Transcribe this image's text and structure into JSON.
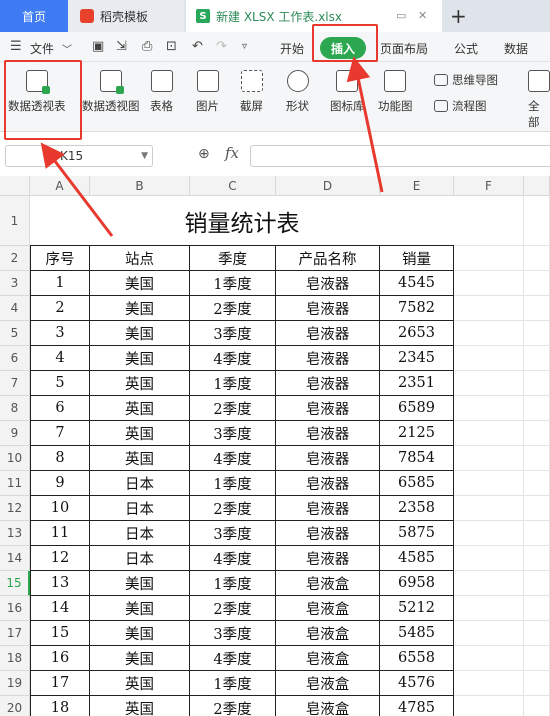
{
  "tabs": {
    "home": "首页",
    "template": "稻壳模板",
    "doc": "新建 XLSX 工作表.xlsx",
    "new_tab": "+"
  },
  "menubar": {
    "file": "文件",
    "items": [
      "开始",
      "插入",
      "页面布局",
      "公式",
      "数据"
    ],
    "active": "插入"
  },
  "ribbon": {
    "pivot_table": "数据透视表",
    "pivot_chart": "数据透视图",
    "table": "表格",
    "picture": "图片",
    "screenshot": "截屏",
    "shape": "形状",
    "icon_lib": "图标库",
    "function_chart": "功能图",
    "mindmap": "思维导图",
    "flowchart": "流程图",
    "more": "全部"
  },
  "formula_bar": {
    "name_box": "K15",
    "fx": "fx",
    "value": ""
  },
  "columns": [
    "A",
    "B",
    "C",
    "D",
    "E",
    "F"
  ],
  "active_row": "15",
  "sheet": {
    "title": "销量统计表",
    "headers": [
      "序号",
      "站点",
      "季度",
      "产品名称",
      "销量"
    ],
    "rows": [
      {
        "row": "3",
        "cells": [
          "1",
          "美国",
          "1季度",
          "皂液器",
          "4545"
        ]
      },
      {
        "row": "4",
        "cells": [
          "2",
          "美国",
          "2季度",
          "皂液器",
          "7582"
        ]
      },
      {
        "row": "5",
        "cells": [
          "3",
          "美国",
          "3季度",
          "皂液器",
          "2653"
        ]
      },
      {
        "row": "6",
        "cells": [
          "4",
          "美国",
          "4季度",
          "皂液器",
          "2345"
        ]
      },
      {
        "row": "7",
        "cells": [
          "5",
          "英国",
          "1季度",
          "皂液器",
          "2351"
        ]
      },
      {
        "row": "8",
        "cells": [
          "6",
          "英国",
          "2季度",
          "皂液器",
          "6589"
        ]
      },
      {
        "row": "9",
        "cells": [
          "7",
          "英国",
          "3季度",
          "皂液器",
          "2125"
        ]
      },
      {
        "row": "10",
        "cells": [
          "8",
          "英国",
          "4季度",
          "皂液器",
          "7854"
        ]
      },
      {
        "row": "11",
        "cells": [
          "9",
          "日本",
          "1季度",
          "皂液器",
          "6585"
        ]
      },
      {
        "row": "12",
        "cells": [
          "10",
          "日本",
          "2季度",
          "皂液器",
          "2358"
        ]
      },
      {
        "row": "13",
        "cells": [
          "11",
          "日本",
          "3季度",
          "皂液器",
          "5875"
        ]
      },
      {
        "row": "14",
        "cells": [
          "12",
          "日本",
          "4季度",
          "皂液器",
          "4585"
        ]
      },
      {
        "row": "15",
        "cells": [
          "13",
          "美国",
          "1季度",
          "皂液盒",
          "6958"
        ]
      },
      {
        "row": "16",
        "cells": [
          "14",
          "美国",
          "2季度",
          "皂液盒",
          "5212"
        ]
      },
      {
        "row": "17",
        "cells": [
          "15",
          "美国",
          "3季度",
          "皂液盒",
          "5485"
        ]
      },
      {
        "row": "18",
        "cells": [
          "16",
          "美国",
          "4季度",
          "皂液盒",
          "6558"
        ]
      },
      {
        "row": "19",
        "cells": [
          "17",
          "英国",
          "1季度",
          "皂液盒",
          "4576"
        ]
      },
      {
        "row": "20",
        "cells": [
          "18",
          "英国",
          "2季度",
          "皂液盒",
          "4785"
        ]
      }
    ]
  },
  "colors": {
    "accent": "#2ca64f",
    "home_tab": "#3f7cf3",
    "annotation": "#e8392f"
  }
}
